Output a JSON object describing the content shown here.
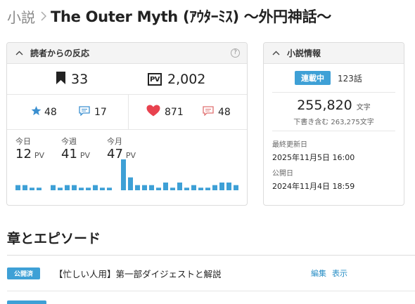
{
  "breadcrumb": {
    "root": "小説",
    "title": "The Outer Myth (ｱｳﾀｰﾐｽ) 〜外円神話〜"
  },
  "reactions": {
    "title": "読者からの反応",
    "help": "?",
    "bookmarks": "33",
    "pv_badge": "PV",
    "total_pv": "2,002",
    "stars": "48",
    "comments": "17",
    "likes": "871",
    "reviews": "48",
    "pv_stats": [
      {
        "label": "今日",
        "value": "12",
        "unit": "PV"
      },
      {
        "label": "今週",
        "value": "41",
        "unit": "PV"
      },
      {
        "label": "今月",
        "value": "47",
        "unit": "PV"
      }
    ],
    "daily_pv": [
      2,
      2,
      1,
      1,
      0,
      2,
      1,
      2,
      2,
      1,
      1,
      2,
      1,
      1,
      0,
      12,
      5,
      2,
      2,
      2,
      1,
      3,
      1,
      3,
      1,
      2,
      1,
      1,
      2,
      3,
      3,
      2
    ],
    "bar_color": "#3ea0d6"
  },
  "novel_info": {
    "title": "小説情報",
    "status": "連載中",
    "episodes": "123話",
    "chars": "255,820",
    "chars_unit": "文字",
    "chars_incl_draft": "下書き含む 263,275文字",
    "last_updated_label": "最終更新日",
    "last_updated": "2025年11月5日 16:00",
    "published_label": "公開日",
    "published": "2024年11月4日 18:59"
  },
  "chapters": {
    "title": "章とエピソード",
    "episodes": [
      {
        "status": "公開済",
        "title": "【忙しい人用】第一部ダイジェストと解説",
        "edit": "編集",
        "view": "表示"
      }
    ]
  },
  "colors": {
    "accent": "#3ea0d6",
    "heart": "#e8424f",
    "review": "#e07070",
    "star": "#3a8fd0"
  }
}
